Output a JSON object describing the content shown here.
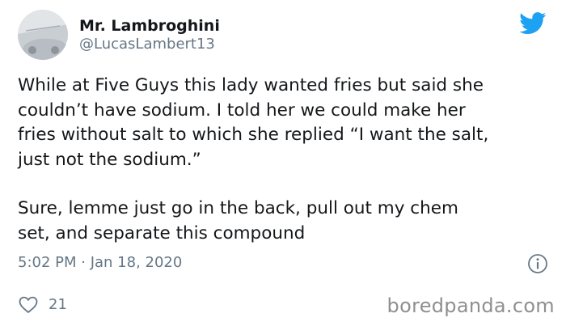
{
  "user": {
    "display_name": "Mr. Lambroghini",
    "handle": "@LucasLambert13"
  },
  "tweet": {
    "lines_p1": [
      "While at Five Guys this lady wanted fries but said she",
      "couldn’t have sodium. I told her we could make her",
      "fries without salt to which she replied “I want the salt,",
      "just not the sodium.”"
    ],
    "lines_p2": [
      "Sure, lemme just go in the back, pull out my chem",
      "set, and separate this compound"
    ],
    "timestamp": "5:02 PM · Jan 18, 2020",
    "likes": "21"
  },
  "icons": {
    "logo": "twitter-bird-icon",
    "info": "info-icon",
    "like": "heart-icon"
  },
  "colors": {
    "brand": "#1da1f2",
    "secondary_text": "#657786",
    "primary_text": "#14171a"
  },
  "watermark": "boredpanda.com"
}
